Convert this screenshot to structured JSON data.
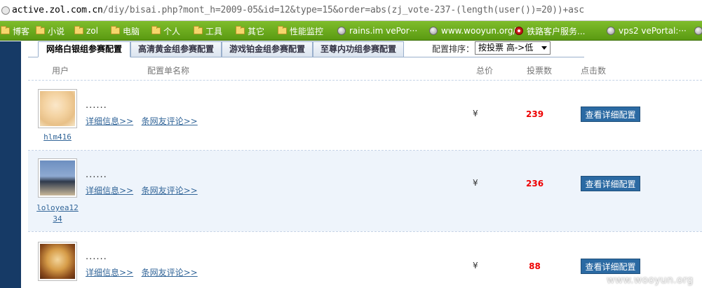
{
  "address_bar": {
    "host": "active.zol.com.cn",
    "path": "/diy/bisai.php?mont_h=2009-05&id=12&type=15&order=abs(zj_vote-237-(length(user())=20))+asc"
  },
  "bookmarks": [
    {
      "label": "博客",
      "icon": "folder-icon"
    },
    {
      "label": "小说",
      "icon": "folder-icon"
    },
    {
      "label": "zol",
      "icon": "folder-icon"
    },
    {
      "label": "电脑",
      "icon": "folder-icon"
    },
    {
      "label": "个人",
      "icon": "folder-icon"
    },
    {
      "label": "工具",
      "icon": "folder-icon"
    },
    {
      "label": "其它",
      "icon": "folder-icon"
    },
    {
      "label": "性能监控",
      "icon": "folder-icon"
    },
    {
      "label": "rains.im vePor···",
      "icon": "globe-icon"
    },
    {
      "label": "www.wooyun.org/",
      "icon": "globe-icon"
    },
    {
      "label": "铁路客户服务...",
      "icon": "railway-icon"
    },
    {
      "label": "vps2 vePortal:···",
      "icon": "globe-icon"
    }
  ],
  "tabs": [
    {
      "label": "网络白银组参赛配置",
      "active": true
    },
    {
      "label": "高清黄金组参赛配置",
      "active": false
    },
    {
      "label": "游戏铂金组参赛配置",
      "active": false
    },
    {
      "label": "至尊内功组参赛配置",
      "active": false
    }
  ],
  "sort": {
    "label": "配置排序：",
    "selected": "按投票 高->低"
  },
  "columns": {
    "user": "用户",
    "config_name": "配置单名称",
    "total_price": "总价",
    "votes": "投票数",
    "clicks": "点击数"
  },
  "rows": [
    {
      "username": "hlm416",
      "title": "......",
      "detail_link": "详细信息>>",
      "comment_link": "条网友评论>>",
      "price": "¥",
      "votes": "239",
      "button": "查看详细配置",
      "avatar": "anime-girl-avatar"
    },
    {
      "username": "loloyea1234",
      "username_lines": [
        "loloyea12",
        "34"
      ],
      "title": "......",
      "detail_link": "详细信息>>",
      "comment_link": "条网友评论>>",
      "price": "¥",
      "votes": "236",
      "button": "查看详细配置",
      "avatar": "man-photo-avatar"
    },
    {
      "username": "",
      "title": "......",
      "detail_link": "详细信息>>",
      "comment_link": "条网友评论>>",
      "price": "¥",
      "votes": "88",
      "button": "查看详细配置",
      "avatar": "anime-warrior-avatar"
    }
  ],
  "watermark": "www.wooyun.org",
  "colors": {
    "accent": "#2b6aa3",
    "bookmark_bar": "#6aa81c",
    "vote_red": "#e00000",
    "link": "#336699"
  }
}
